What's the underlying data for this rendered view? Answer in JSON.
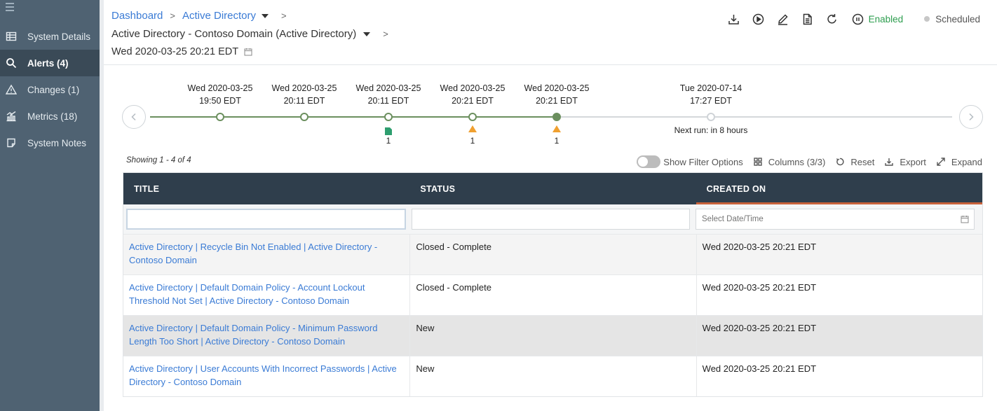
{
  "sidebar": {
    "items": [
      {
        "label": "System Details",
        "icon": "table-icon"
      },
      {
        "label": "Alerts (4)",
        "icon": "search-icon",
        "active": true
      },
      {
        "label": "Changes (1)",
        "icon": "warning-icon"
      },
      {
        "label": "Metrics (18)",
        "icon": "chart-icon"
      },
      {
        "label": "System Notes",
        "icon": "note-icon"
      }
    ]
  },
  "header": {
    "breadcrumb": {
      "dashboard": "Dashboard",
      "section": "Active Directory",
      "system": "Active Directory - Contoso Domain (Active Directory)",
      "run": "Wed 2020-03-25 20:21 EDT"
    },
    "toolbar": {
      "enabled_label": "Enabled",
      "scheduled_label": "Scheduled",
      "enabled_color": "#2e9e4f"
    }
  },
  "timeline": {
    "points": [
      {
        "date": "Wed 2020-03-25",
        "time": "19:50 EDT",
        "state": "past"
      },
      {
        "date": "Wed 2020-03-25",
        "time": "20:11 EDT",
        "state": "past"
      },
      {
        "date": "Wed 2020-03-25",
        "time": "20:11 EDT",
        "state": "past",
        "marker": "document-icon",
        "count": "1"
      },
      {
        "date": "Wed 2020-03-25",
        "time": "20:21 EDT",
        "state": "past",
        "marker": "warning-triangle-icon",
        "count": "1"
      },
      {
        "date": "Wed 2020-03-25",
        "time": "20:21 EDT",
        "state": "current",
        "marker": "warning-triangle-icon",
        "count": "1"
      },
      {
        "date": "Tue 2020-07-14",
        "time": "17:27 EDT",
        "state": "future",
        "note": "Next run: in 8 hours"
      }
    ],
    "colors": {
      "active_line": "#6b8f5e",
      "future_line": "#d5d8db",
      "warning": "#f0a030",
      "document": "#2e9e6f"
    }
  },
  "table": {
    "showing": "Showing 1 - 4 of 4",
    "tools": {
      "filter_toggle": "Show Filter Options",
      "columns": "Columns (3/3)",
      "reset": "Reset",
      "export": "Export",
      "expand": "Expand"
    },
    "columns": [
      "TITLE",
      "STATUS",
      "CREATED ON"
    ],
    "filters": {
      "title_value": "",
      "status_value": "",
      "date_placeholder": "Select Date/Time"
    },
    "rows": [
      {
        "title": "Active Directory | Recycle Bin Not Enabled | Active Directory - Contoso Domain",
        "status": "Closed - Complete",
        "created": "Wed 2020-03-25 20:21 EDT"
      },
      {
        "title": "Active Directory | Default Domain Policy - Account Lockout Threshold Not Set | Active Directory - Contoso Domain",
        "status": "Closed - Complete",
        "created": "Wed 2020-03-25 20:21 EDT"
      },
      {
        "title": "Active Directory | Default Domain Policy - Minimum Password Length Too Short | Active Directory - Contoso Domain",
        "status": "New",
        "created": "Wed 2020-03-25 20:21 EDT"
      },
      {
        "title": "Active Directory | User Accounts With Incorrect Passwords | Active Directory - Contoso Domain",
        "status": "New",
        "created": "Wed 2020-03-25 20:21 EDT"
      }
    ]
  }
}
